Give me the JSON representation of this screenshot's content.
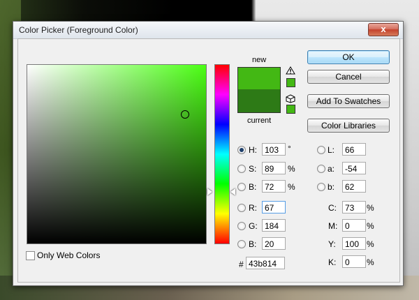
{
  "window": {
    "title": "Color Picker (Foreground Color)",
    "close_glyph": "x"
  },
  "colors": {
    "new": "#43b814",
    "current": "#2d7a16",
    "field_hue": "#4bff14"
  },
  "preview": {
    "new_label": "new",
    "current_label": "current",
    "warning_icon": "warning-triangle-icon",
    "cube_icon": "web-safe-cube-icon"
  },
  "buttons": {
    "ok": "OK",
    "cancel": "Cancel",
    "add_swatches": "Add To Swatches",
    "libraries": "Color Libraries"
  },
  "hsb": {
    "h": {
      "label": "H:",
      "value": "103",
      "unit": "°",
      "selected": true
    },
    "s": {
      "label": "S:",
      "value": "89",
      "unit": "%"
    },
    "b": {
      "label": "B:",
      "value": "72",
      "unit": "%"
    }
  },
  "lab": {
    "l": {
      "label": "L:",
      "value": "66"
    },
    "a": {
      "label": "a:",
      "value": "-54"
    },
    "b": {
      "label": "b:",
      "value": "62"
    }
  },
  "rgb": {
    "r": {
      "label": "R:",
      "value": "67"
    },
    "g": {
      "label": "G:",
      "value": "184"
    },
    "b": {
      "label": "B:",
      "value": "20"
    }
  },
  "cmyk": {
    "c": {
      "label": "C:",
      "value": "73",
      "unit": "%"
    },
    "m": {
      "label": "M:",
      "value": "0",
      "unit": "%"
    },
    "y": {
      "label": "Y:",
      "value": "100",
      "unit": "%"
    },
    "k": {
      "label": "K:",
      "value": "0",
      "unit": "%"
    }
  },
  "hex": {
    "label": "#",
    "value": "43b814"
  },
  "web_colors": {
    "label": "Only Web Colors",
    "checked": false
  }
}
